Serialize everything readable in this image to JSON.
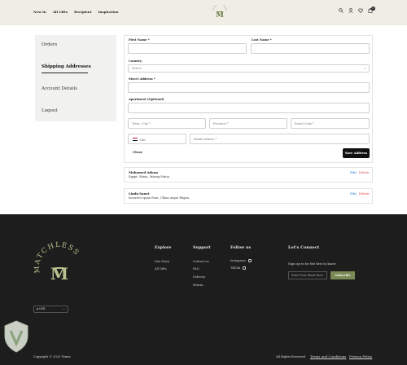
{
  "header": {
    "nav": [
      "New In",
      "All Gifts",
      "Recipient",
      "Inspiration"
    ],
    "logo_text": "MATCHLESS",
    "icons": [
      "search-icon",
      "user-icon",
      "heart-icon",
      "cart-icon"
    ],
    "cart_count": "0"
  },
  "sidebar": {
    "items": [
      {
        "label": "Orders"
      },
      {
        "label": "Shipping Addresses",
        "active": true
      },
      {
        "label": "Account Details"
      },
      {
        "label": "Logout"
      }
    ]
  },
  "form": {
    "first_name_label": "First Name *",
    "last_name_label": "Last Name *",
    "country_label": "Country",
    "country_value": "Select...",
    "street_label": "Street Address *",
    "apartment_label": "Apartment (Optional)",
    "town_placeholder": "Town / City *",
    "province_placeholder": "Province *",
    "postal_placeholder": "Postal Code *",
    "country_code": "+20",
    "email_placeholder": "Email address *",
    "clear_label": "Clear",
    "save_label": "Save Address"
  },
  "addresses": [
    {
      "name": "Mohamed Adnan",
      "line": "Egypt, Minia, Maxug Minia,",
      "edit": "Edit",
      "delete": "Delete"
    },
    {
      "name": "Linda Sanet",
      "line": "Incorrect quae Esse, Ullam atque Eligen,",
      "edit": "Edit",
      "delete": "Delete"
    }
  ],
  "footer": {
    "explore": {
      "title": "Explore",
      "items": [
        "Our Story",
        "All Gifts"
      ]
    },
    "support": {
      "title": "Support",
      "items": [
        "Contact us",
        "FAQ",
        "Delivery",
        "Return"
      ]
    },
    "follow": {
      "title": "Follow us",
      "items": [
        "Instagram",
        "TikTok"
      ]
    },
    "connect_title": "Let's Connect",
    "connect_sub": "Sign up to be the first to know",
    "email_placeholder": "Enter Your Email Here",
    "subscribe_label": "Subscribe",
    "currency": "USD",
    "copyright": "Copyright © 2025 Terms",
    "rights": "All Rights Reserved",
    "terms": "Terms and Conditions",
    "privacy": "Privacy Policy"
  },
  "colors": {
    "header_bg": "#efede4",
    "footer_bg": "#1d1d1d",
    "brand_green": "#7b8a55",
    "edit": "#2a7de1",
    "delete": "#e03c3c"
  }
}
